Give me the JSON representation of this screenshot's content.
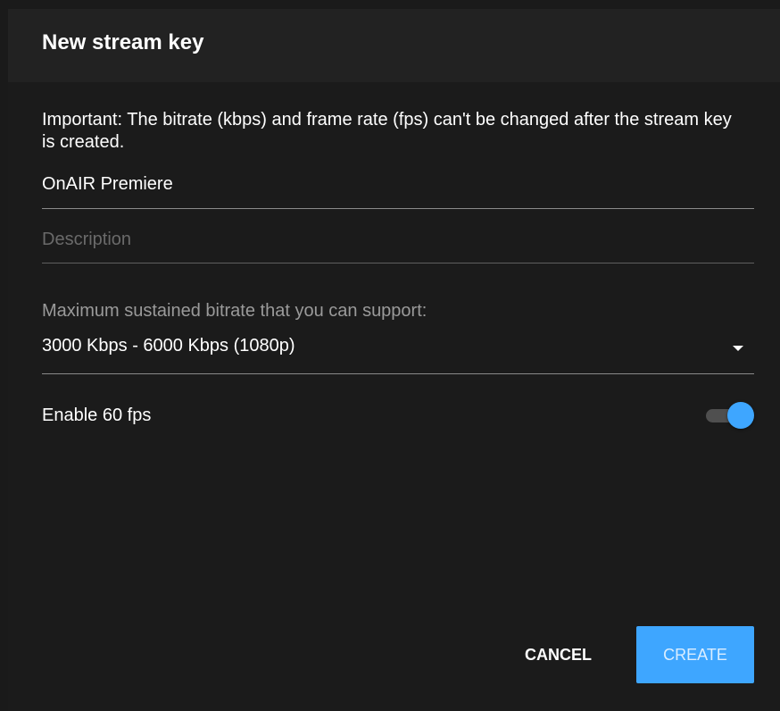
{
  "dialog": {
    "title": "New stream key",
    "notice": "Important: The bitrate (kbps) and frame rate (fps) can't be changed after the stream key is created.",
    "name_value": "OnAIR Premiere",
    "description_placeholder": "Description",
    "bitrate_label": "Maximum sustained bitrate that you can support:",
    "bitrate_selected": "3000 Kbps - 6000 Kbps (1080p)",
    "fps_toggle_label": "Enable 60 fps",
    "fps_enabled": true,
    "cancel_label": "CANCEL",
    "create_label": "CREATE"
  },
  "colors": {
    "accent": "#3ea6ff",
    "background": "#1b1b1b",
    "header": "#222222"
  },
  "icons": {
    "dropdown": "caret-down-icon"
  }
}
